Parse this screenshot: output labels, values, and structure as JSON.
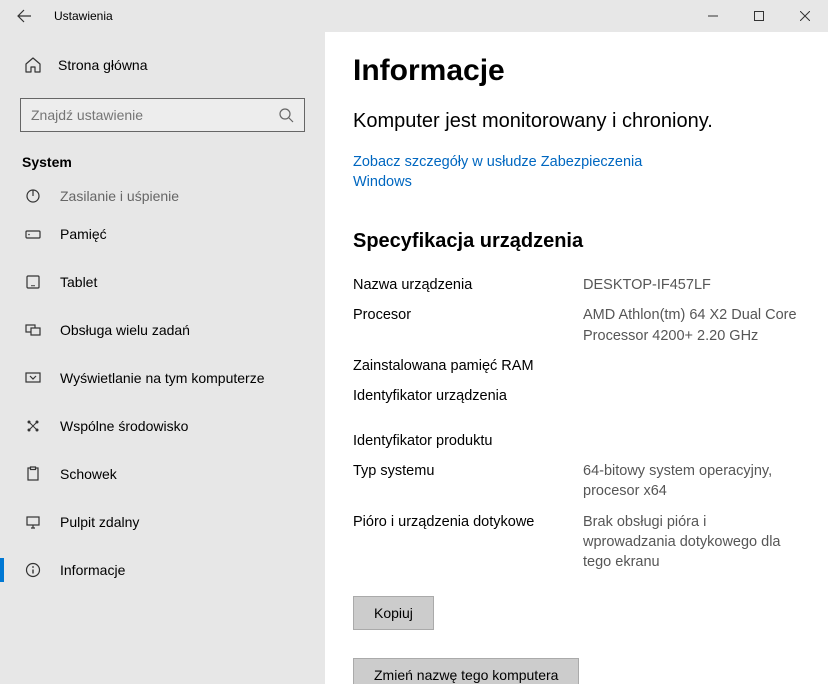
{
  "window": {
    "title": "Ustawienia"
  },
  "sidebar": {
    "home": "Strona główna",
    "search_placeholder": "Znajdź ustawienie",
    "category": "System",
    "items": [
      {
        "label": "Zasilanie i uśpienie"
      },
      {
        "label": "Pamięć"
      },
      {
        "label": "Tablet"
      },
      {
        "label": "Obsługa wielu zadań"
      },
      {
        "label": "Wyświetlanie na tym komputerze"
      },
      {
        "label": "Wspólne środowisko"
      },
      {
        "label": "Schowek"
      },
      {
        "label": "Pulpit zdalny"
      },
      {
        "label": "Informacje"
      }
    ]
  },
  "main": {
    "title": "Informacje",
    "protection": "Komputer jest monitorowany i chroniony.",
    "security_link": "Zobacz szczegóły w usłudze Zabezpieczenia Windows",
    "spec_title": "Specyfikacja urządzenia",
    "specs": {
      "device_name_label": "Nazwa urządzenia",
      "device_name_value": "DESKTOP-IF457LF",
      "processor_label": "Procesor",
      "processor_value": "AMD Athlon(tm) 64 X2 Dual Core Processor 4200+   2.20 GHz",
      "ram_label": "Zainstalowana pamięć RAM",
      "ram_value": "",
      "device_id_label": "Identyfikator urządzenia",
      "device_id_value": "",
      "product_id_label": "Identyfikator produktu",
      "product_id_value": "",
      "system_type_label": "Typ systemu",
      "system_type_value": "64-bitowy system operacyjny, procesor x64",
      "pen_label": "Pióro i urządzenia dotykowe",
      "pen_value": "Brak obsługi pióra i wprowadzania dotykowego dla tego ekranu"
    },
    "copy_btn": "Kopiuj",
    "rename_btn": "Zmień nazwę tego komputera"
  }
}
